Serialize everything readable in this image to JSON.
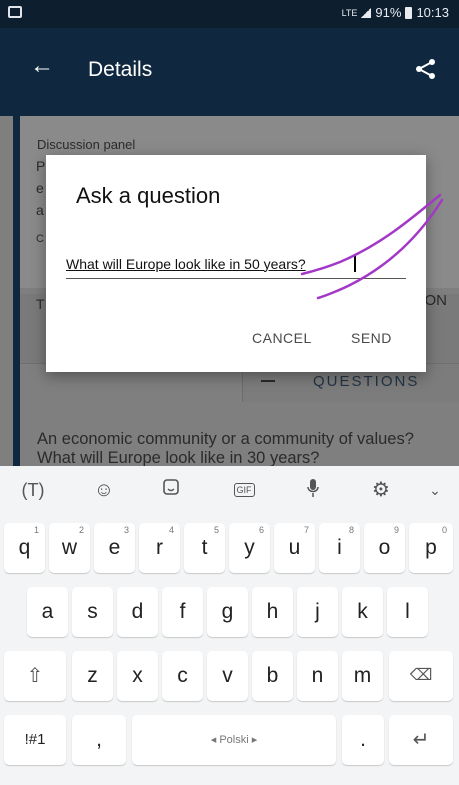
{
  "status_bar": {
    "network": "LTE",
    "battery": "91%",
    "time": "10:13"
  },
  "app_bar": {
    "title": "Details"
  },
  "background": {
    "panel_label": "Discussion panel",
    "ghost_letters": [
      "P",
      "e",
      "a",
      "C"
    ],
    "tab_fragment_left": "T",
    "tab_fragment_right": "ON",
    "questions_tab": "QUESTIONS",
    "body_text": "An economic community or a community of values? What will Europe look like in 30 years?"
  },
  "dialog": {
    "title": "Ask a question",
    "question_value": "What will Europe look like in 50 years?",
    "cancel_label": "CANCEL",
    "send_label": "SEND"
  },
  "keyboard": {
    "toolbar_icons": [
      "text-recognition-icon",
      "emoji-icon",
      "sticker-icon",
      "gif-icon",
      "microphone-icon",
      "settings-icon",
      "chevron-down-icon"
    ],
    "gif_label": "GIF",
    "row1": [
      {
        "k": "q",
        "s": "1"
      },
      {
        "k": "w",
        "s": "2"
      },
      {
        "k": "e",
        "s": "3"
      },
      {
        "k": "r",
        "s": "4"
      },
      {
        "k": "t",
        "s": "5"
      },
      {
        "k": "y",
        "s": "6"
      },
      {
        "k": "u",
        "s": "7"
      },
      {
        "k": "i",
        "s": "8"
      },
      {
        "k": "o",
        "s": "9"
      },
      {
        "k": "p",
        "s": "0"
      }
    ],
    "row2": [
      "a",
      "s",
      "d",
      "f",
      "g",
      "h",
      "j",
      "k",
      "l"
    ],
    "row3": [
      "z",
      "x",
      "c",
      "v",
      "b",
      "n",
      "m"
    ],
    "symbols_label": "!#1",
    "comma_label": ",",
    "space_label": "◂ Polski ▸",
    "period_label": "."
  },
  "annotation_color": "#a338c8"
}
